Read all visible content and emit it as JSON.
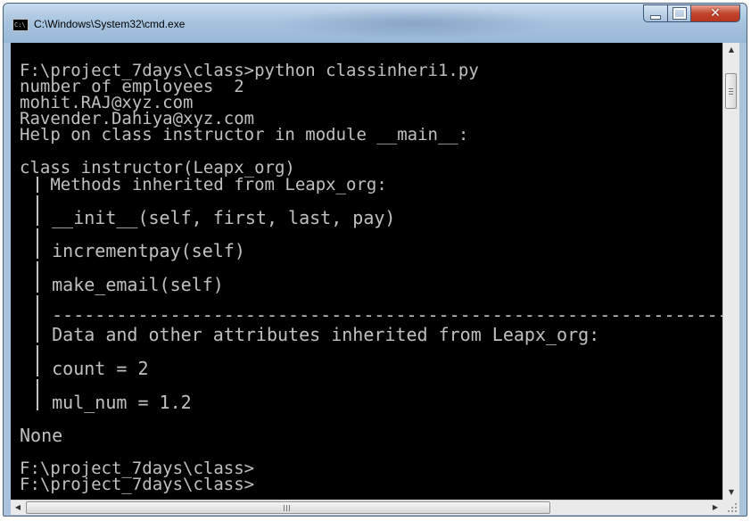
{
  "window": {
    "title": "C:\\Windows\\System32\\cmd.exe",
    "icon": "cmd-icon",
    "icon_text": "C:\\",
    "controls": {
      "minimize": "minimize-icon",
      "maximize": "maximize-icon",
      "close": "close-icon",
      "close_glyph": "✕"
    }
  },
  "console": {
    "lines": [
      "F:\\project_7days\\class>python classinheri1.py",
      "number of employees  2",
      "mohit.RAJ@xyz.com",
      "Ravender.Dahiya@xyz.com",
      "Help on class instructor in module __main__:",
      "class instructor(Leapx_org)",
      "   Methods inherited from Leapx_org:",
      "   __init__(self, first, last, pay)",
      "   incrementpay(self)",
      "   make_email(self)",
      "   ----------------------------------------------------------------",
      "   Data and other attributes inherited from Leapx_org:",
      "   count = 2",
      "   mul_num = 1.2",
      "None",
      "F:\\project_7days\\class>",
      "F:\\project_7days\\class>"
    ]
  },
  "scrollbars": {
    "vertical": {
      "up": "▲",
      "down": "▼"
    },
    "horizontal": {
      "left": "◀",
      "right": "▶"
    }
  },
  "colors": {
    "console_bg": "#000000",
    "console_fg": "#c0c0c0",
    "close_button": "#c2452c",
    "frame": "#a9c3dc"
  }
}
